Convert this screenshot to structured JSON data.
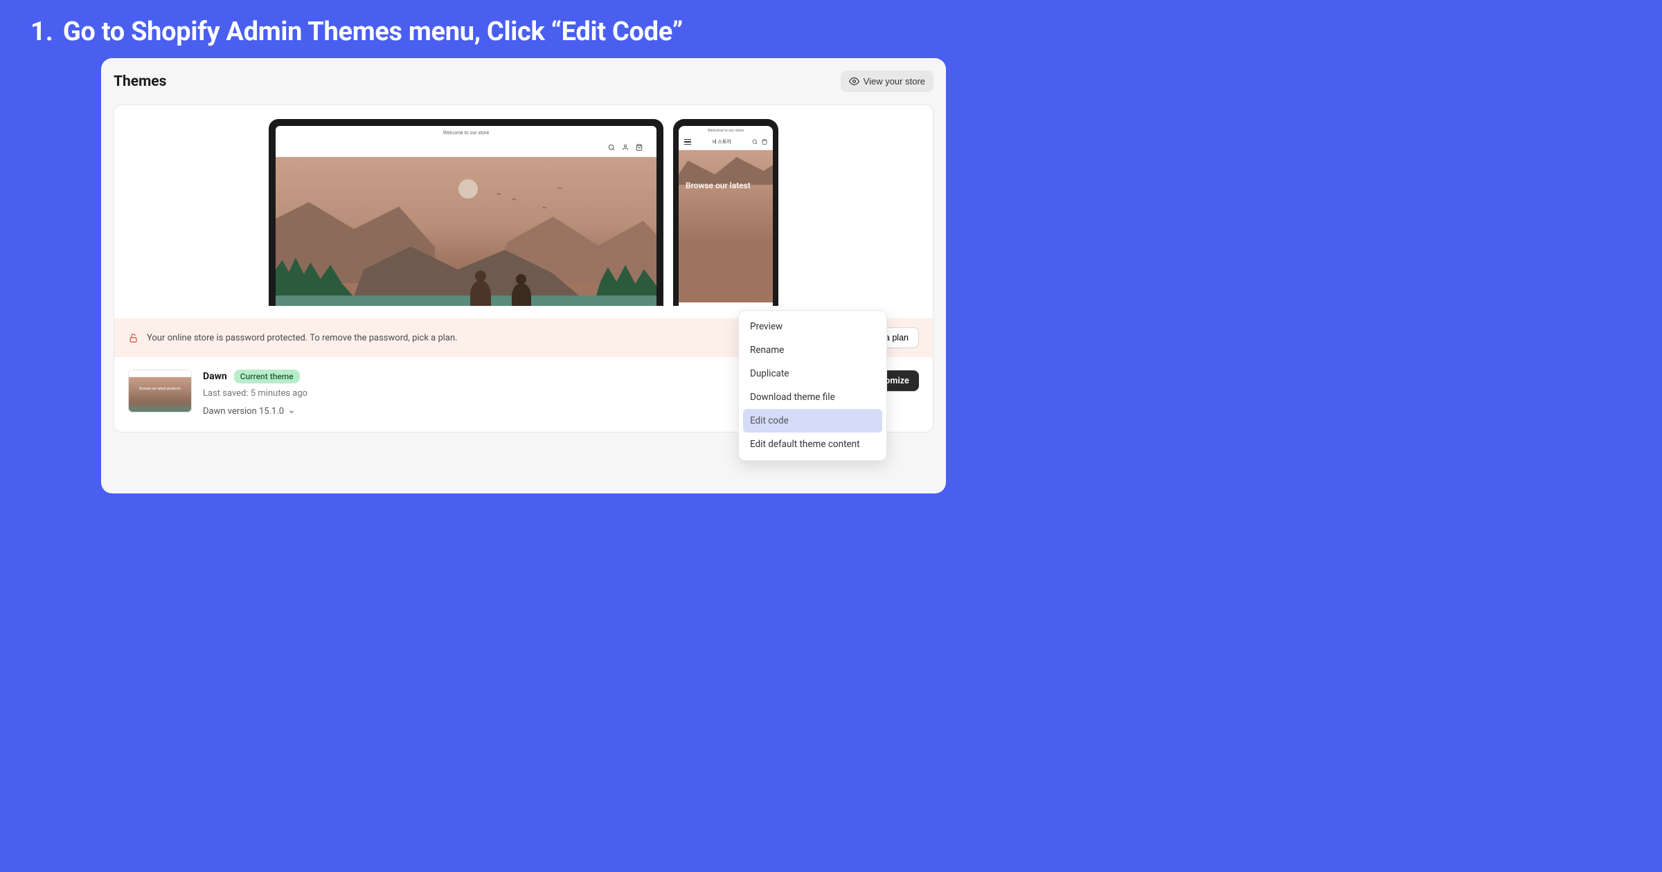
{
  "instruction": {
    "number": "1.",
    "text": "Go to Shopify Admin Themes menu, Click  “Edit Code”"
  },
  "page": {
    "title": "Themes",
    "view_store_label": "View your store"
  },
  "desktop_preview": {
    "welcome_text": "Welcome to our store"
  },
  "mobile_preview": {
    "welcome_text": "Welcome to our store",
    "store_name": "내 스토어",
    "hero_text": "Browse our latest"
  },
  "banner": {
    "text": "Your online store is password protected. To remove the password, pick a plan.",
    "pick_plan_label": "Pick a plan"
  },
  "current_theme": {
    "name": "Dawn",
    "badge": "Current theme",
    "last_saved": "Last saved: 5 minutes ago",
    "version": "Dawn version 15.1.0",
    "thumb_text": "Browse our latest products",
    "customize_label": "Customize"
  },
  "dropdown": {
    "items": [
      "Preview",
      "Rename",
      "Duplicate",
      "Download theme file",
      "Edit code",
      "Edit default theme content"
    ],
    "highlighted_index": 4
  }
}
